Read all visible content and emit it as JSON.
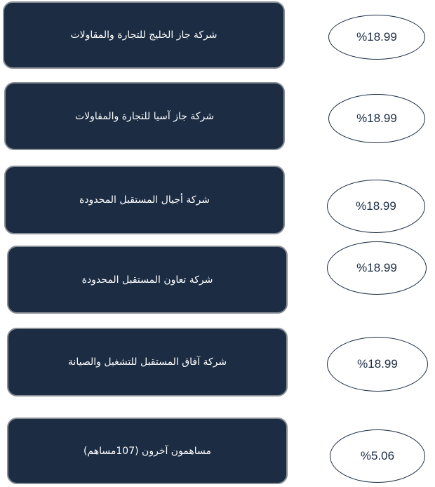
{
  "colors": {
    "box_fill": "#1b2c43",
    "box_border": "#8a8f96",
    "ellipse_border": "#1b2c43",
    "box_text": "#ffffff",
    "ellipse_text": "#1b2c43"
  },
  "rows": [
    {
      "company": "شركة جاز الخليج للتجارة والمقاولات",
      "share": "%18.99"
    },
    {
      "company": "شركة جاز آسيا للتجارة والمقاولات",
      "share": "%18.99"
    },
    {
      "company": "شركة أجيال المستقبل المحدودة",
      "share": "%18.99"
    },
    {
      "company": "شركة تعاون المستقبل المحدودة",
      "share": "%18.99"
    },
    {
      "company": "شركة آفاق المستقبل للتشغيل والصيانة",
      "share": "%18.99"
    },
    {
      "company": "مساهمون آخرون (107مساهم)",
      "share": "%5.06"
    }
  ]
}
